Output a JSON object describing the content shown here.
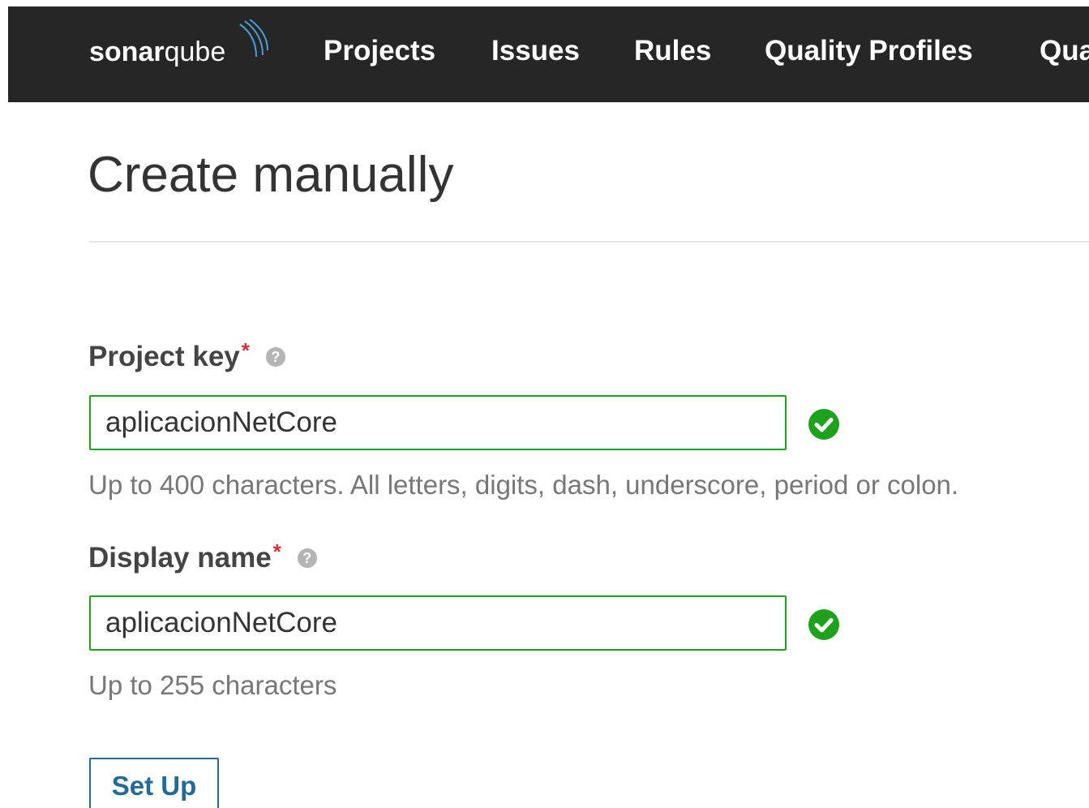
{
  "navbar": {
    "logo": {
      "part1": "sonar",
      "part2": "qube"
    },
    "items": [
      {
        "label": "Projects"
      },
      {
        "label": "Issues"
      },
      {
        "label": "Rules"
      },
      {
        "label": "Quality Profiles"
      },
      {
        "label": "Qua"
      }
    ]
  },
  "page": {
    "title": "Create manually"
  },
  "form": {
    "project_key": {
      "label": "Project key",
      "required_mark": "*",
      "value": "aplicacionNetCore",
      "hint": "Up to 400 characters. All letters, digits, dash, underscore, period or colon.",
      "status_icon": "check-circle-icon"
    },
    "display_name": {
      "label": "Display name",
      "required_mark": "*",
      "value": "aplicacionNetCore",
      "hint": "Up to 255 characters",
      "status_icon": "check-circle-icon"
    },
    "help_icon": "question-circle-icon",
    "help_glyph": "?",
    "submit_label": "Set Up"
  },
  "colors": {
    "navbar_bg": "#262626",
    "valid_border": "#1ea21e",
    "required": "#d02f3a",
    "button": "#236a97"
  }
}
